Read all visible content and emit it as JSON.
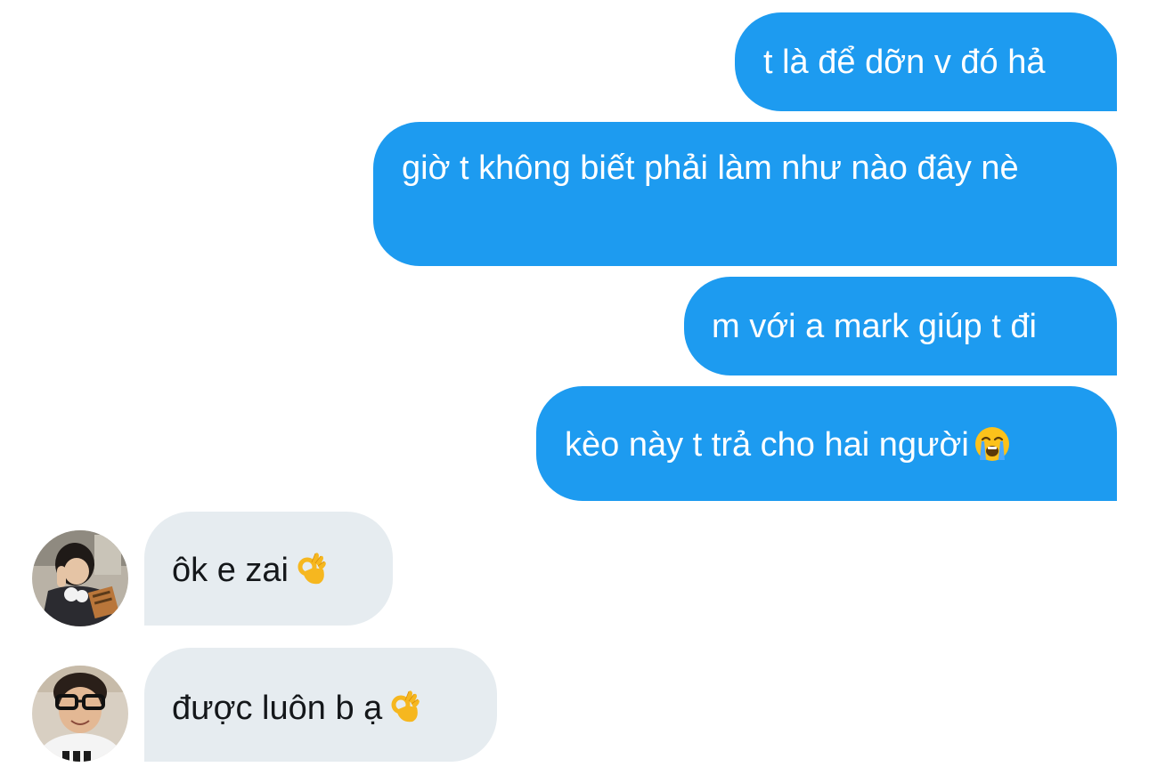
{
  "conversation": {
    "messages": [
      {
        "sender": "me",
        "text": "t là để dỡn v đó hả"
      },
      {
        "sender": "me",
        "text": "giờ t không biết phải làm như nào đây nè"
      },
      {
        "sender": "me",
        "text": "m với a mark giúp t đi"
      },
      {
        "sender": "me",
        "text": "kèo này t trả cho hai người",
        "emoji": "loudly-crying-face"
      },
      {
        "sender": "other",
        "text": "ôk e zai",
        "emoji": "ok-hand"
      },
      {
        "sender": "other",
        "text": "được luôn b ạ",
        "emoji": "ok-hand"
      }
    ]
  },
  "colors": {
    "outgoing_bubble": "#1d9bf0",
    "incoming_bubble": "#e6ecf0",
    "outgoing_text": "#ffffff",
    "incoming_text": "#14171a"
  }
}
